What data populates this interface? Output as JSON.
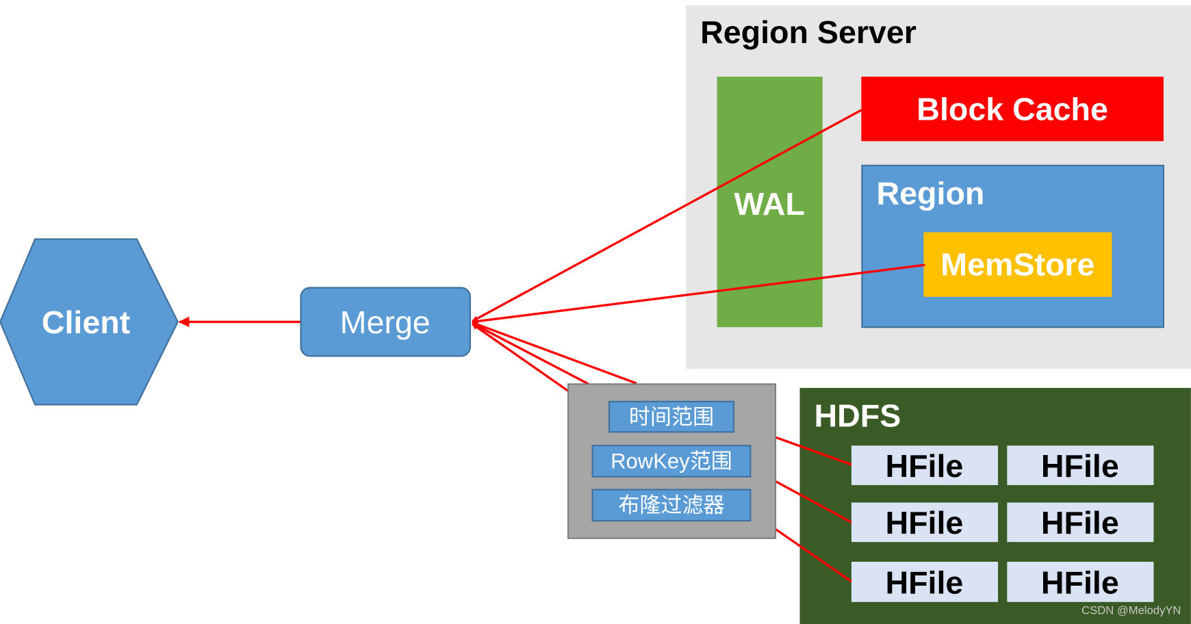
{
  "region_server": {
    "title": "Region Server",
    "wal": "WAL",
    "block_cache": "Block Cache",
    "region": "Region",
    "memstore": "MemStore"
  },
  "client": "Client",
  "merge": "Merge",
  "filters": [
    "时间范围",
    "RowKey范围",
    "布隆过滤器"
  ],
  "hdfs": {
    "title": "HDFS",
    "files": [
      "HFile",
      "HFile",
      "HFile",
      "HFile",
      "HFile",
      "HFile"
    ]
  },
  "watermark": "CSDN @MelodyYN",
  "colors": {
    "arrow": "#ff0000",
    "region_server_bg": "#e6e6e6",
    "wal": "#70ad47",
    "block_cache": "#ff0000",
    "region": "#5b9bd5",
    "memstore": "#ffc000",
    "hdfs": "#3a5a26",
    "hfile": "#dae3f3",
    "filter_panel": "#a6a6a6"
  }
}
